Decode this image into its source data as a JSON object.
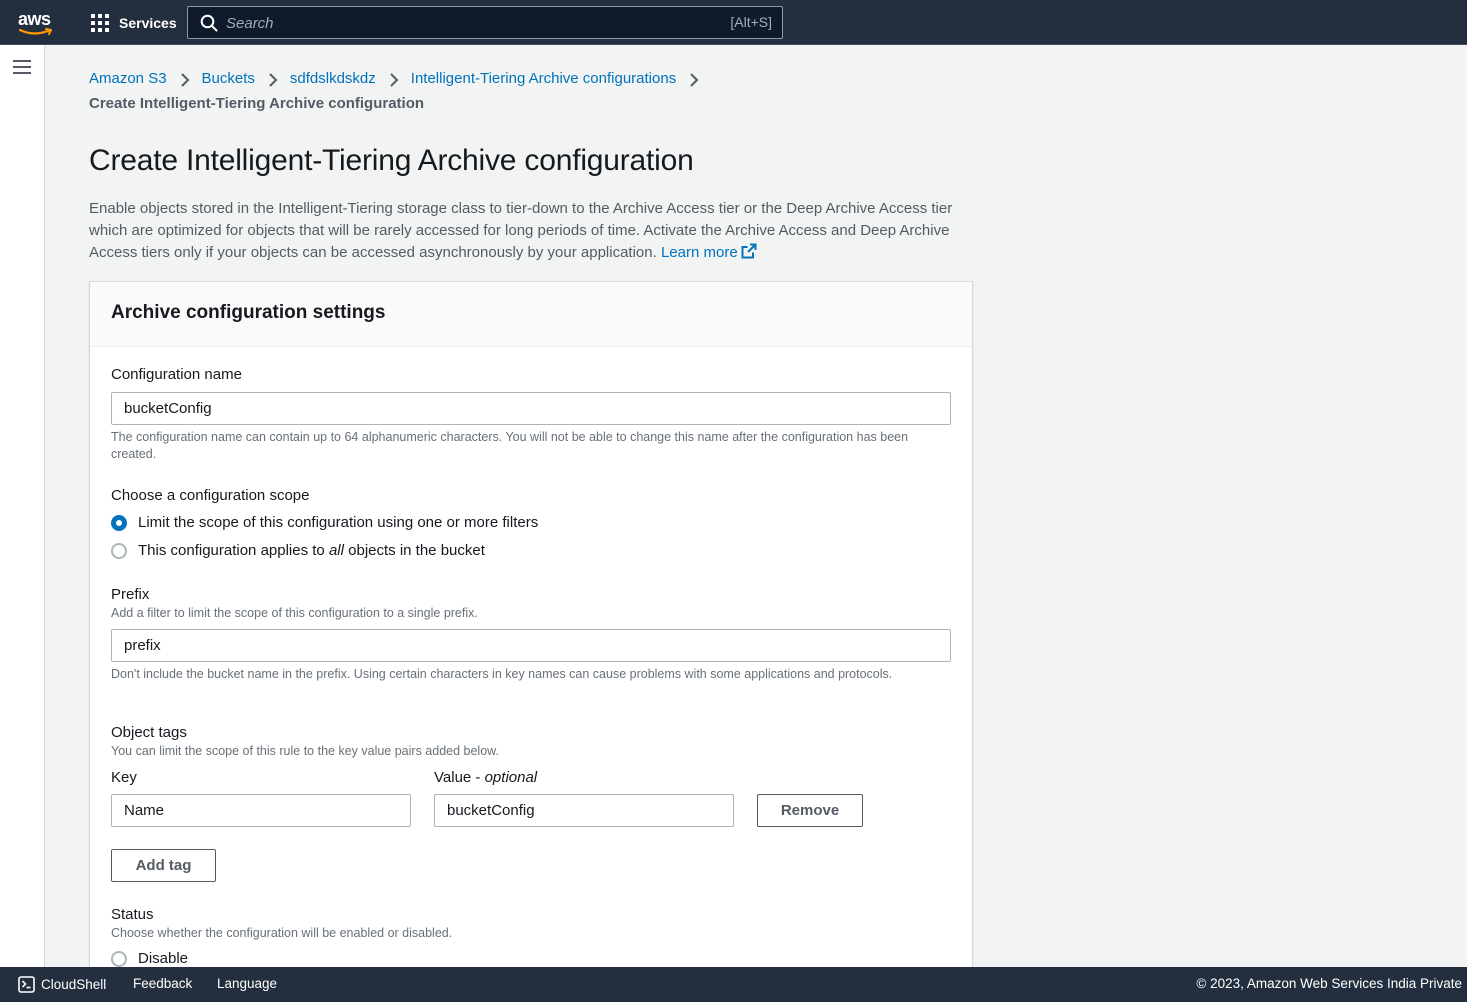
{
  "topnav": {
    "logo_text": "aws",
    "services_label": "Services",
    "search_placeholder": "Search",
    "search_shortcut": "[Alt+S]"
  },
  "breadcrumb": {
    "items": [
      "Amazon S3",
      "Buckets",
      "sdfdslkdskdz",
      "Intelligent-Tiering Archive configurations"
    ],
    "current": "Create Intelligent-Tiering Archive configuration"
  },
  "page": {
    "title": "Create Intelligent-Tiering Archive configuration",
    "description": "Enable objects stored in the Intelligent-Tiering storage class to tier-down to the Archive Access tier or the Deep Archive Access tier which are optimized for objects that will be rarely accessed for long periods of time. Activate the Archive Access and Deep Archive Access tiers only if your objects can be accessed asynchronously by your application.",
    "learn_more": "Learn more"
  },
  "panel": {
    "title": "Archive configuration settings",
    "config_name": {
      "label": "Configuration name",
      "value": "bucketConfig",
      "hint": "The configuration name can contain up to 64 alphanumeric characters. You will not be able to change this name after the configuration has been created."
    },
    "scope": {
      "label": "Choose a configuration scope",
      "option_filters": "Limit the scope of this configuration using one or more filters",
      "option_all_prefix": "This configuration applies to ",
      "option_all_em": "all",
      "option_all_suffix": " objects in the bucket",
      "selected": "filters"
    },
    "prefix": {
      "label": "Prefix",
      "description": "Add a filter to limit the scope of this configuration to a single prefix.",
      "value": "prefix",
      "hint": "Don't include the bucket name in the prefix. Using certain characters in key names can cause problems with some applications and protocols."
    },
    "tags": {
      "label": "Object tags",
      "description": "You can limit the scope of this rule to the key value pairs added below.",
      "key_label": "Key",
      "value_label": "Value - ",
      "value_optional": "optional",
      "key_value": "Name",
      "value_value": "bucketConfig",
      "remove_label": "Remove",
      "add_label": "Add tag"
    },
    "status": {
      "label": "Status",
      "description": "Choose whether the configuration will be enabled or disabled.",
      "option_disable": "Disable"
    }
  },
  "footer": {
    "cloudshell": "CloudShell",
    "feedback": "Feedback",
    "language": "Language",
    "copyright": "© 2023, Amazon Web Services India Private"
  },
  "colors": {
    "nav_bg": "#232f3e",
    "link": "#0073bb",
    "aws_orange": "#ff9900"
  }
}
